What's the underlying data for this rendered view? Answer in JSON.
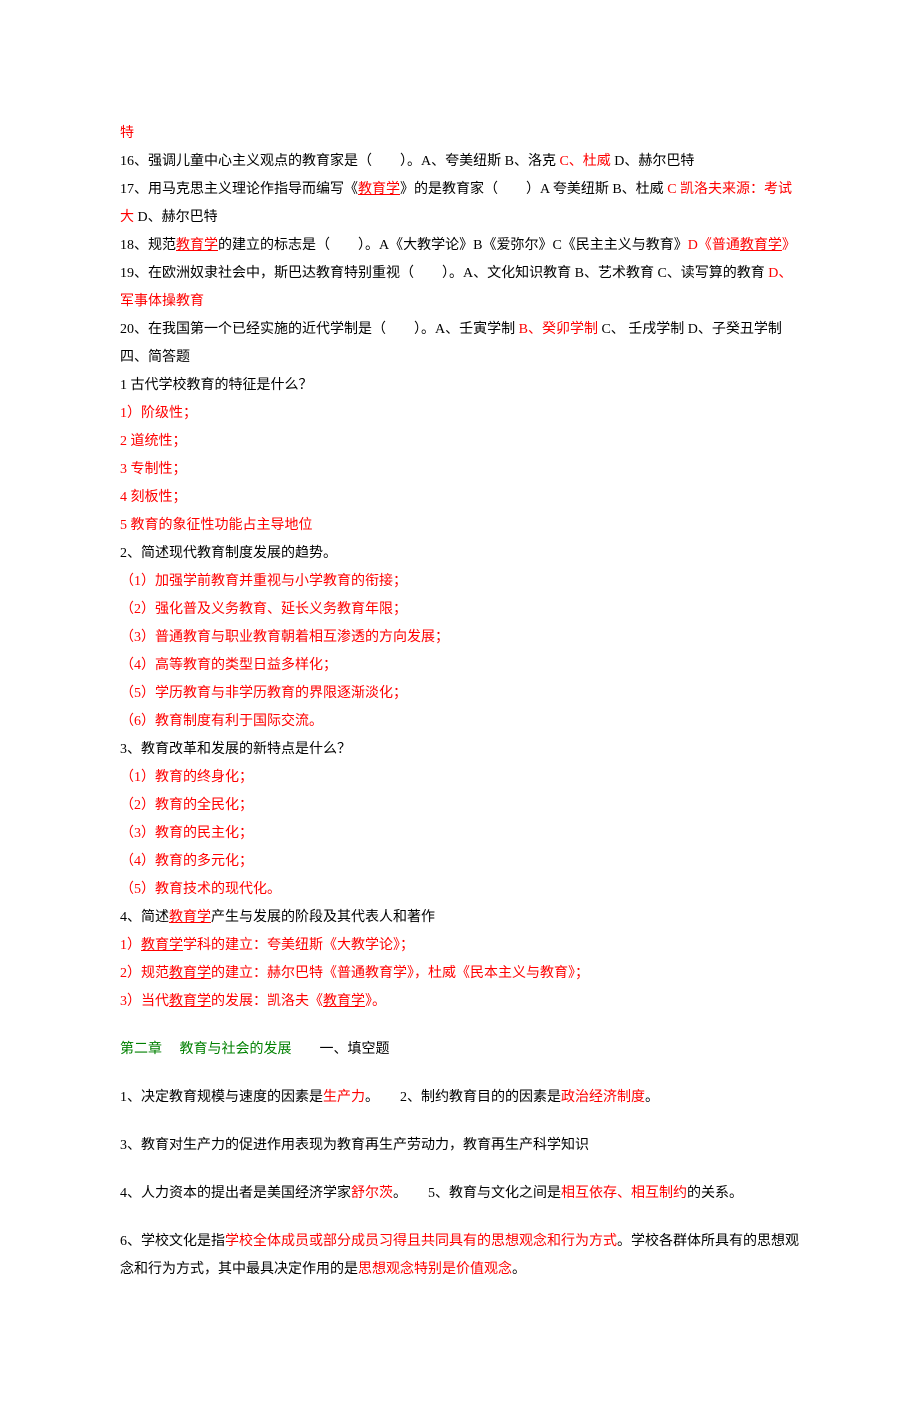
{
  "lines": [
    {
      "segments": [
        {
          "text": "特",
          "cls": "red"
        }
      ]
    },
    {
      "segments": [
        {
          "text": "16、强调儿童中心主义观点的教育家是（　　）。A、夸美纽斯 B、洛克 "
        },
        {
          "text": "C、杜威",
          "cls": "red"
        },
        {
          "text": " D、赫尔巴特"
        }
      ]
    },
    {
      "segments": [
        {
          "text": "17、用马克思主义理论作指导而编写《"
        },
        {
          "text": "教育学",
          "cls": "link"
        },
        {
          "text": "》的是教育家（　　）A 夸美纽斯 B、杜威 "
        },
        {
          "text": "C 凯洛夫来源：考试大",
          "cls": "red"
        },
        {
          "text": " D、赫尔巴特"
        }
      ]
    },
    {
      "segments": [
        {
          "text": "18、规范"
        },
        {
          "text": "教育学",
          "cls": "link"
        },
        {
          "text": "的建立的标志是（　　）。A《大教学论》B《爱弥尔》C《民主主义与教育》"
        },
        {
          "text": "D《普通",
          "cls": "red"
        },
        {
          "text": "教育学",
          "cls": "link"
        },
        {
          "text": "》",
          "cls": "red"
        }
      ]
    },
    {
      "segments": [
        {
          "text": "19、在欧洲奴隶社会中，斯巴达教育特别重视（　　）。A、文化知识教育 B、艺术教育 C、读写算的教育 "
        },
        {
          "text": "D、军事体操教育",
          "cls": "red"
        }
      ]
    },
    {
      "segments": [
        {
          "text": "20、在我国第一个已经实施的近代学制是（　　）。A、壬寅学制 "
        },
        {
          "text": "B、癸卯学制",
          "cls": "red"
        },
        {
          "text": " C、 壬戌学制 D、子癸丑学制"
        }
      ]
    },
    {
      "segments": [
        {
          "text": "四、简答题"
        }
      ]
    },
    {
      "segments": [
        {
          "text": "1 古代学校教育的特征是什么？"
        }
      ]
    },
    {
      "segments": [
        {
          "text": "1）阶级性；",
          "cls": "red"
        }
      ]
    },
    {
      "segments": [
        {
          "text": "2 道统性；",
          "cls": "red"
        }
      ]
    },
    {
      "segments": [
        {
          "text": "3 专制性；",
          "cls": "red"
        }
      ]
    },
    {
      "segments": [
        {
          "text": "4 刻板性；",
          "cls": "red"
        }
      ]
    },
    {
      "segments": [
        {
          "text": "5 教育的象征性功能占主导地位",
          "cls": "red"
        }
      ]
    },
    {
      "segments": [
        {
          "text": "2、简述现代教育制度发展的趋势。"
        }
      ]
    },
    {
      "segments": [
        {
          "text": "（1）加强学前教育并重视与小学教育的衔接；",
          "cls": "red"
        }
      ]
    },
    {
      "segments": [
        {
          "text": "（2）强化普及义务教育、延长义务教育年限；",
          "cls": "red"
        }
      ]
    },
    {
      "segments": [
        {
          "text": "（3）普通教育与职业教育朝着相互渗透的方向发展；",
          "cls": "red"
        }
      ]
    },
    {
      "segments": [
        {
          "text": "（4）高等教育的类型日益多样化；",
          "cls": "red"
        }
      ]
    },
    {
      "segments": [
        {
          "text": "（5）学历教育与非学历教育的界限逐渐淡化；",
          "cls": "red"
        }
      ]
    },
    {
      "segments": [
        {
          "text": "（6）教育制度有利于国际交流。",
          "cls": "red"
        }
      ]
    },
    {
      "segments": [
        {
          "text": "3、教育改革和发展的新特点是什么？"
        }
      ]
    },
    {
      "segments": [
        {
          "text": "（1）教育的终身化；",
          "cls": "red"
        }
      ]
    },
    {
      "segments": [
        {
          "text": "（2）教育的全民化；",
          "cls": "red"
        }
      ]
    },
    {
      "segments": [
        {
          "text": "（3）教育的民主化；",
          "cls": "red"
        }
      ]
    },
    {
      "segments": [
        {
          "text": "（4）教育的多元化；",
          "cls": "red"
        }
      ]
    },
    {
      "segments": [
        {
          "text": "（5）教育技术的现代化。",
          "cls": "red"
        }
      ]
    },
    {
      "segments": [
        {
          "text": "4、简述"
        },
        {
          "text": "教育学",
          "cls": "link"
        },
        {
          "text": "产生与发展的阶段及其代表人和著作"
        }
      ]
    },
    {
      "segments": [
        {
          "text": "1）",
          "cls": "red"
        },
        {
          "text": "教育学",
          "cls": "link"
        },
        {
          "text": "学科的建立：夸美纽斯《大教学论》；",
          "cls": "red"
        }
      ]
    },
    {
      "segments": [
        {
          "text": "2）规范",
          "cls": "red"
        },
        {
          "text": "教育学",
          "cls": "link"
        },
        {
          "text": "的建立：赫尔巴特《普通教育学》，杜威《民本主义与教育》；",
          "cls": "red"
        }
      ]
    },
    {
      "segments": [
        {
          "text": "3）当代",
          "cls": "red"
        },
        {
          "text": "教育学",
          "cls": "link"
        },
        {
          "text": "的发展：凯洛夫《",
          "cls": "red"
        },
        {
          "text": "教育学",
          "cls": "link"
        },
        {
          "text": "》。",
          "cls": "red"
        }
      ]
    },
    {
      "segments": [
        {
          "text": "第二章　 教育与社会的发展",
          "cls": "green"
        },
        {
          "text": "　　一、填空题"
        }
      ],
      "gap": true
    },
    {
      "segments": [
        {
          "text": "1、决定教育规模与速度的因素是"
        },
        {
          "text": "生产力",
          "cls": "red"
        },
        {
          "text": "。　　2、制约教育目的的因素是"
        },
        {
          "text": "政治经济制度",
          "cls": "red"
        },
        {
          "text": "。"
        }
      ],
      "gap": true
    },
    {
      "segments": [
        {
          "text": "3、教育对生产力的促进作用表现为教育再生产劳动力，教育再生产科学知识"
        }
      ],
      "gap": true
    },
    {
      "segments": [
        {
          "text": "4、人力资本的提出者是美国经济学家"
        },
        {
          "text": "舒尔茨",
          "cls": "red"
        },
        {
          "text": "。　　5、教育与文化之间是"
        },
        {
          "text": "相互依存、相互制约",
          "cls": "red"
        },
        {
          "text": "的关系。"
        }
      ],
      "gap": true
    },
    {
      "segments": [
        {
          "text": "6、学校文化是指"
        },
        {
          "text": "学校全体成员或部分成员习得且共同具有的思想观念和行为方式",
          "cls": "red"
        },
        {
          "text": "。学校各群体所具有的思想观念和行为方式，其中最具决定作用的是"
        },
        {
          "text": "思想观念特别是价值观念",
          "cls": "red"
        },
        {
          "text": "。"
        }
      ],
      "gap": true
    }
  ]
}
